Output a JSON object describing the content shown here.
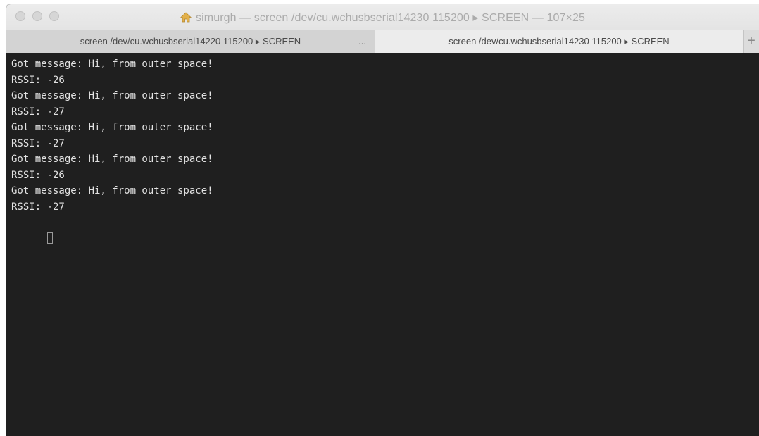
{
  "window": {
    "title": "simurgh — screen /dev/cu.wchusbserial14230 115200 ▸ SCREEN — 107×25",
    "title_icon": "home-icon"
  },
  "tabs": [
    {
      "label": "screen /dev/cu.wchusbserial14220 115200 ▸ SCREEN",
      "active": false
    },
    {
      "label": "screen /dev/cu.wchusbserial14230 115200 ▸ SCREEN",
      "active": true
    }
  ],
  "tab_overflow_label": "...",
  "new_tab_label": "+",
  "terminal": {
    "lines": [
      "Got message: Hi, from outer space!",
      "RSSI: -26",
      "Got message: Hi, from outer space!",
      "RSSI: -27",
      "Got message: Hi, from outer space!",
      "RSSI: -27",
      "Got message: Hi, from outer space!",
      "RSSI: -26",
      "Got message: Hi, from outer space!",
      "RSSI: -27"
    ]
  },
  "colors": {
    "terminal_bg": "#1f1f1f",
    "terminal_fg": "#e2e2e2",
    "titlebar": "#e8e8e8"
  }
}
